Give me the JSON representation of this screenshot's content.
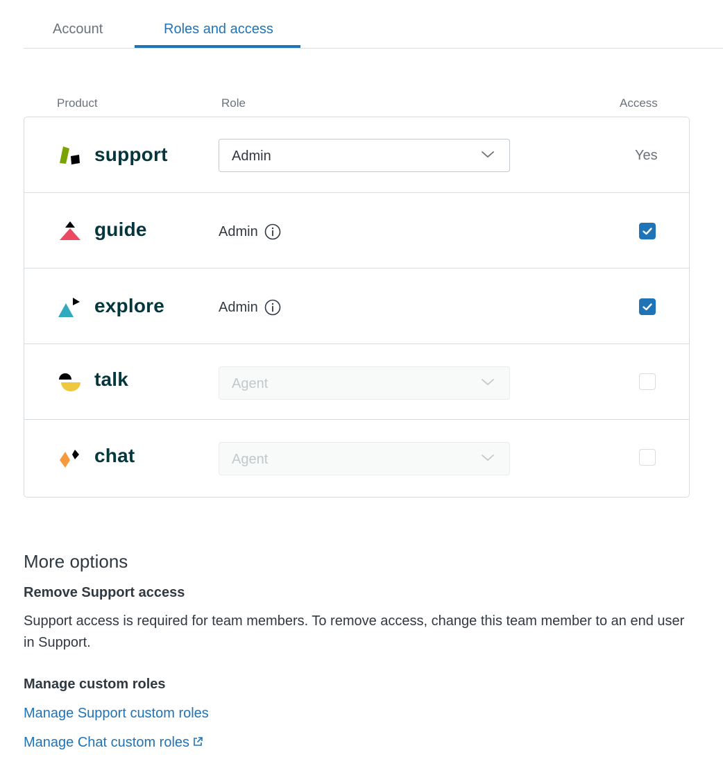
{
  "tabs": [
    {
      "label": "Account",
      "active": false
    },
    {
      "label": "Roles and access",
      "active": true
    }
  ],
  "table": {
    "headers": {
      "product": "Product",
      "role": "Role",
      "access": "Access"
    },
    "rows": [
      {
        "product": "support",
        "role": "Admin",
        "role_type": "select",
        "access": "Yes",
        "access_type": "text"
      },
      {
        "product": "guide",
        "role": "Admin",
        "role_type": "text-info",
        "access_type": "checkbox",
        "checked": true
      },
      {
        "product": "explore",
        "role": "Admin",
        "role_type": "text-info",
        "access_type": "checkbox",
        "checked": true
      },
      {
        "product": "talk",
        "role": "Agent",
        "role_type": "select-disabled",
        "access_type": "checkbox",
        "checked": false
      },
      {
        "product": "chat",
        "role": "Agent",
        "role_type": "select-disabled",
        "access_type": "checkbox",
        "checked": false
      }
    ]
  },
  "more_options": {
    "title": "More options",
    "remove_support": {
      "heading": "Remove Support access",
      "text": "Support access is required for team members. To remove access, change this team member to an end user in Support."
    },
    "custom_roles": {
      "heading": "Manage custom roles",
      "links": [
        "Manage Support custom roles",
        "Manage Chat custom roles"
      ]
    }
  },
  "colors": {
    "accent": "#1f73b7",
    "brand_text": "#03363d",
    "support_green": "#78a300",
    "guide_pink": "#eb4962",
    "explore_teal": "#30aabc",
    "talk_yellow": "#efc93d",
    "chat_orange": "#f79a3e"
  }
}
